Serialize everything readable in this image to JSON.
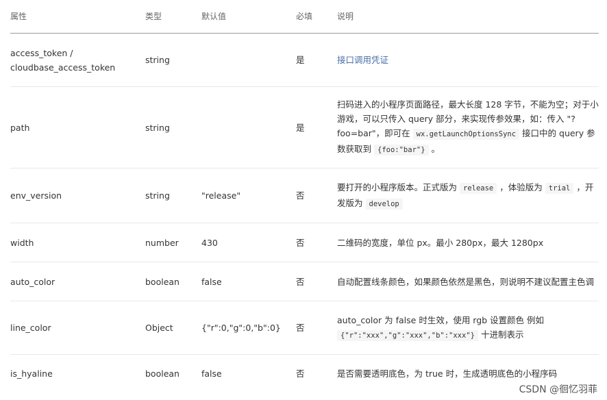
{
  "headers": {
    "attr": "属性",
    "type": "类型",
    "default": "默认值",
    "required": "必填",
    "desc": "说明"
  },
  "rows": [
    {
      "attr_line1": "access_token /",
      "attr_line2": "cloudbase_access_token",
      "type": "string",
      "default": "",
      "required": "是",
      "desc": "接口调用凭证"
    },
    {
      "attr": "path",
      "type": "string",
      "default": "",
      "required": "是",
      "desc_part1": "扫码进入的小程序页面路径，最大长度 128 字节，不能为空；对于小游戏，可以只传入 query 部分，来实现传参效果，如：传入 \"?foo=bar\"，即可在",
      "desc_code1": "wx.getLaunchOptionsSync",
      "desc_part2": "接口中的 query 参数获取到",
      "desc_code2": "{foo:\"bar\"}",
      "desc_part3": "。"
    },
    {
      "attr": "env_version",
      "type": "string",
      "default": "\"release\"",
      "required": "否",
      "desc_part1": "要打开的小程序版本。正式版为",
      "desc_code1": "release",
      "desc_part2": "，体验版为",
      "desc_code2": "trial",
      "desc_part3": "，开发版为",
      "desc_code3": "develop"
    },
    {
      "attr": "width",
      "type": "number",
      "default": "430",
      "required": "否",
      "desc": "二维码的宽度，单位 px。最小 280px，最大 1280px"
    },
    {
      "attr": "auto_color",
      "type": "boolean",
      "default": "false",
      "required": "否",
      "desc": "自动配置线条颜色，如果颜色依然是黑色，则说明不建议配置主色调"
    },
    {
      "attr": "line_color",
      "type": "Object",
      "default": "{\"r\":0,\"g\":0,\"b\":0}",
      "required": "否",
      "desc_part1": "auto_color 为 false 时生效，使用 rgb 设置颜色 例如",
      "desc_code1": "{\"r\":\"xxx\",\"g\":\"xxx\",\"b\":\"xxx\"}",
      "desc_part2": "十进制表示"
    },
    {
      "attr": "is_hyaline",
      "type": "boolean",
      "default": "false",
      "required": "否",
      "desc": "是否需要透明底色，为 true 时，生成透明底色的小程序码"
    }
  ],
  "watermark": "CSDN @徊忆羽菲"
}
